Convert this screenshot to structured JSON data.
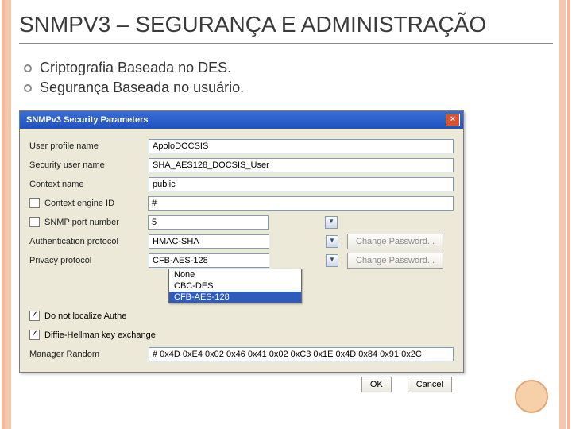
{
  "title": "SNMPV3 – SEGURANÇA E ADMINISTRAÇÃO",
  "bullets": [
    "Criptografia Baseada no DES.",
    "Segurança Baseada no usuário."
  ],
  "dlg": {
    "title": "SNMPv3 Security Parameters",
    "labels": {
      "profile": "User profile name",
      "secuser": "Security user name",
      "context": "Context name",
      "engine": "Context engine ID",
      "port": "SNMP port number",
      "auth": "Authentication protocol",
      "priv": "Privacy protocol",
      "localize": "Do not localize Authe",
      "dh": "Diffie-Hellman key exchange",
      "mgr": "Manager Random"
    },
    "values": {
      "profile": "ApoloDOCSIS",
      "secuser": "SHA_AES128_DOCSIS_User",
      "context": "public",
      "engine": "#",
      "port": "5",
      "auth": "HMAC-SHA",
      "priv": "CFB-AES-128",
      "mgr": "# 0x4D 0xE4 0x02 0x46 0x41 0x02 0xC3 0x1E 0x4D 0x84 0x91 0x2C"
    },
    "privopts": [
      "None",
      "CBC-DES",
      "CFB-AES-128"
    ],
    "buttons": {
      "changepw": "Change Password...",
      "ok": "OK",
      "cancel": "Cancel"
    }
  }
}
